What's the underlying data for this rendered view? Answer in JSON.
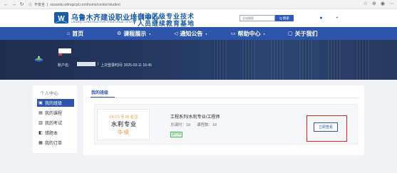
{
  "browser": {
    "security_label": "不安全",
    "url": "xxssedu.wlmqzcpt.com/home/center/student"
  },
  "header": {
    "title_main": "乌鲁木齐建设职业培训中心",
    "title_sub": "URUMQI CONSTRUCTION VOCATIONAL CENTER",
    "title_right_line1": "自治区级专业技术",
    "title_right_line2": "人员继续教育基地",
    "search_placeholder": "全站搜索",
    "search_button": "Q 搜索"
  },
  "nav": {
    "items": [
      {
        "label": "首页",
        "icon": "home-icon"
      },
      {
        "label": "课程展示",
        "icon": "gear-icon"
      },
      {
        "label": "通知公告",
        "icon": "speaker-icon"
      },
      {
        "label": "帮助中心",
        "icon": "chat-icon"
      },
      {
        "label": "关于我们",
        "icon": "window-icon"
      }
    ]
  },
  "banner": {
    "user_label": "账户名:",
    "separator": "|",
    "last_login": "上次登录时间: 2025-03-11 16:45"
  },
  "sidebar": {
    "title": "个人中心",
    "items": [
      {
        "label": "我的班级",
        "icon": "class-icon",
        "active": true
      },
      {
        "label": "我的课程",
        "icon": "course-icon",
        "active": false
      },
      {
        "label": "我的考试",
        "icon": "exam-icon",
        "active": false
      },
      {
        "label": "错题本",
        "icon": "notebook-icon",
        "active": false
      },
      {
        "label": "我的订单",
        "icon": "order-icon",
        "active": false
      }
    ]
  },
  "main": {
    "tab": "我的班级",
    "course": {
      "thumb_line1": "2025年自治区",
      "thumb_line2": "水利专业",
      "thumb_line3": "中级",
      "name": "工程系列/水利专业/工程师",
      "total_label": "总课时：18",
      "lessons_label": "课程数：18",
      "status": "进行中",
      "action_button": "立即查看"
    }
  },
  "colors": {
    "nav_bg": "#2d55ac",
    "brand": "#1a5aa8",
    "highlight": "#e0242b",
    "status_green": "#48b35c"
  }
}
